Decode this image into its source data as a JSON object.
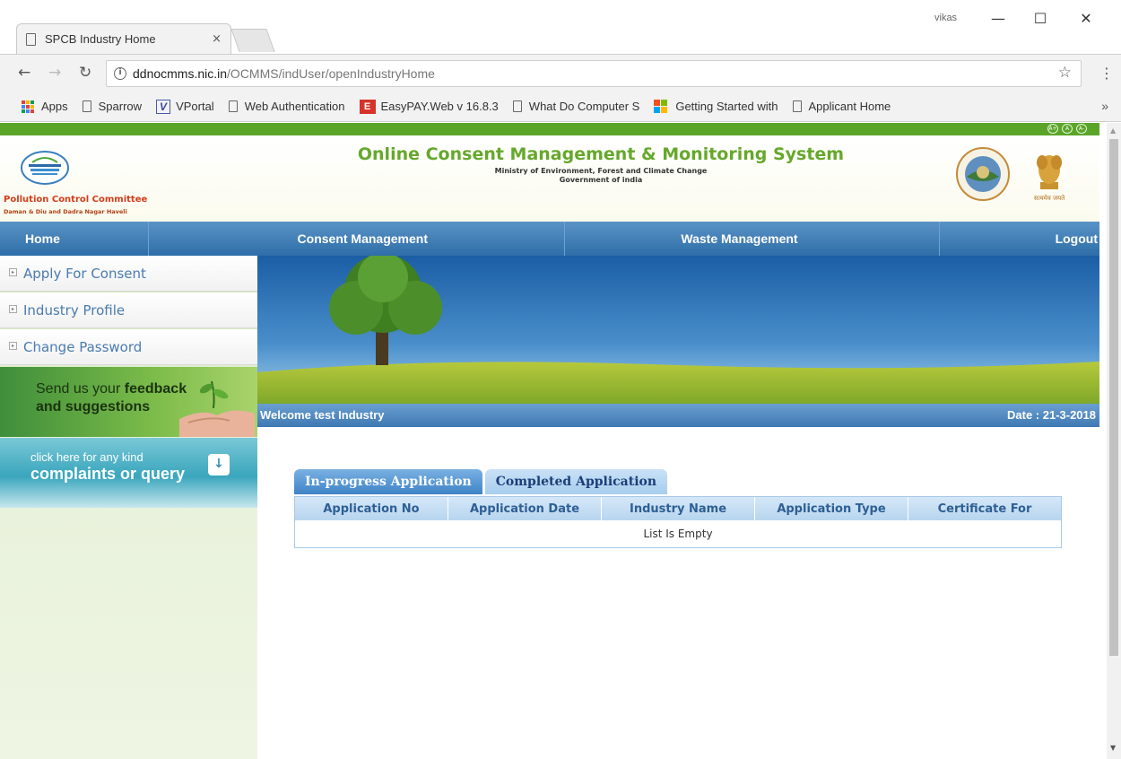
{
  "browser": {
    "tab_title": "SPCB Industry Home",
    "tab_close": "×",
    "user_name": "vikas",
    "url_host": "ddnocmms.nic.in",
    "url_path": "/OCMMS/indUser/openIndustryHome",
    "bookmarks": [
      "Apps",
      "Sparrow",
      "VPortal",
      "Web Authentication",
      "EasyPAY.Web v 16.8.3",
      "What Do Computer S",
      "Getting Started with",
      "Applicant Home"
    ],
    "bookmark_more": "»"
  },
  "header": {
    "title": "Online Consent Management & Monitoring System",
    "ministry": "Ministry of Environment, Forest and Climate Change",
    "government": "Government of india",
    "org_name": "Pollution Control Committee",
    "org_sub": "Daman & Diu and Dadra Nagar Haveli",
    "font_controls": [
      "A+",
      "A",
      "A-"
    ]
  },
  "nav": {
    "items": [
      "Home",
      "Consent Management",
      "Waste Management",
      "Logout"
    ]
  },
  "sidebar": {
    "items": [
      "Apply For Consent",
      "Industry Profile",
      "Change Password"
    ],
    "feedback_line1_prefix": "Send us your ",
    "feedback_line1_bold": "feedback",
    "feedback_line2": "and suggestions",
    "complaint_line1": "click here for any kind",
    "complaint_line2": "complaints or query"
  },
  "welcome": {
    "text": "Welcome test Industry",
    "date": "Date : 21-3-2018"
  },
  "applications": {
    "tabs": [
      "In-progress Application",
      "Completed Application"
    ],
    "active_tab": "In-progress Application",
    "columns": [
      "Application No",
      "Application Date",
      "Industry Name",
      "Application Type",
      "Certificate For"
    ],
    "empty_message": "List Is Empty"
  }
}
